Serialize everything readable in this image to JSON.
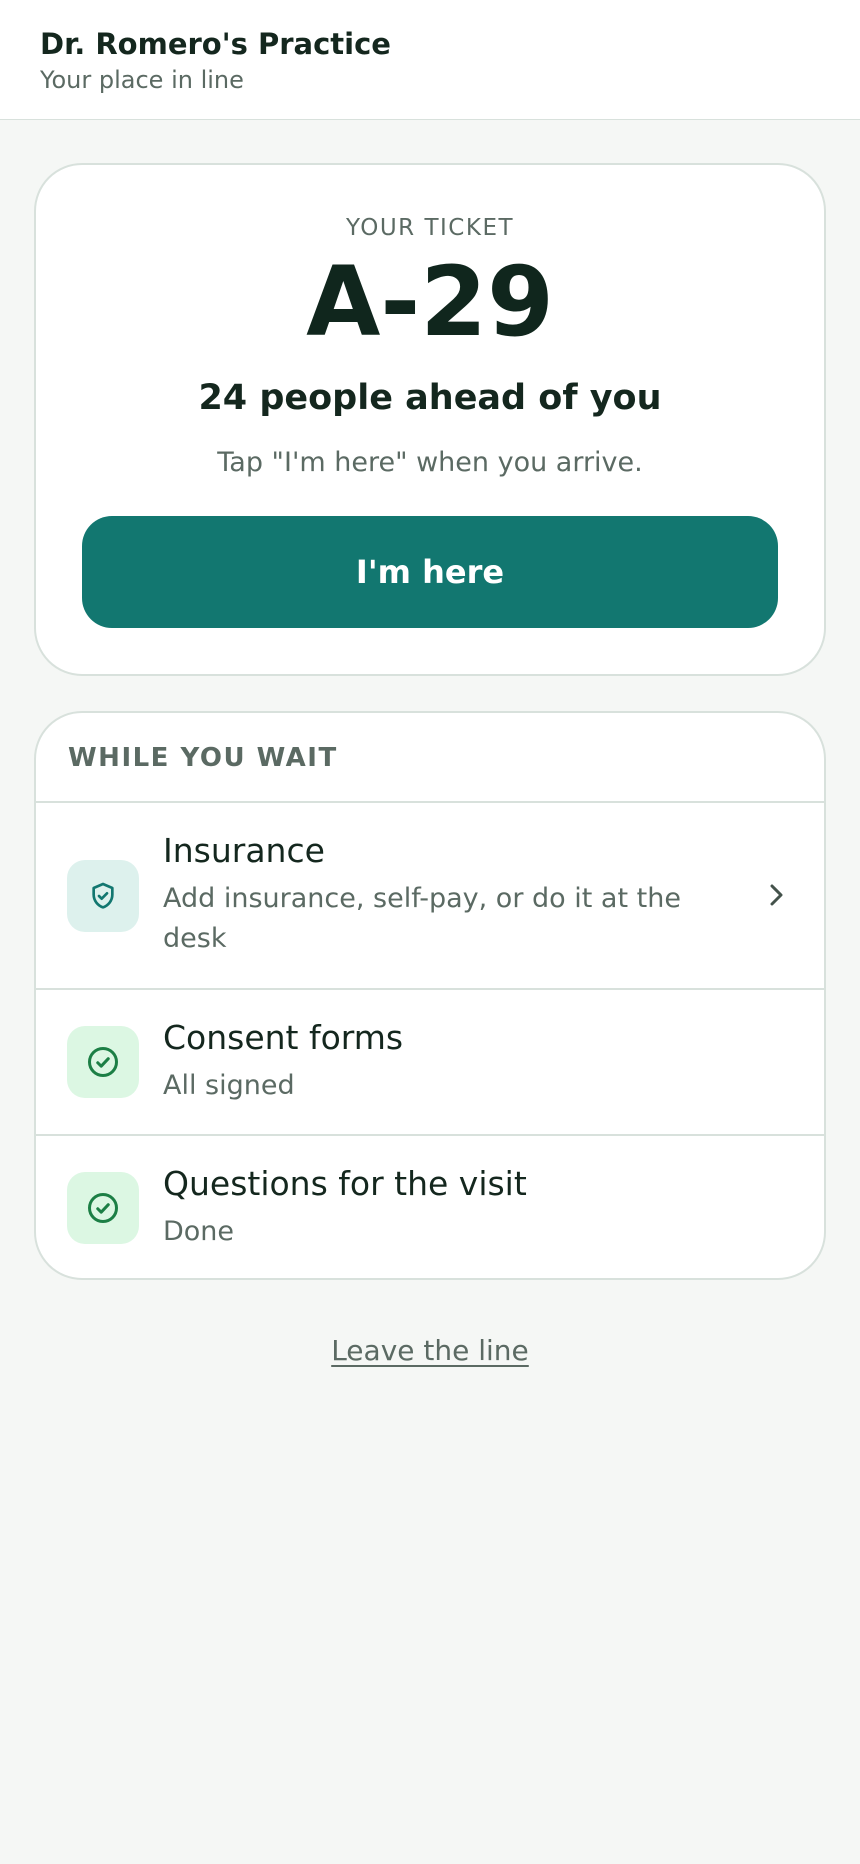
{
  "header": {
    "title": "Dr. Romero's Practice",
    "subtitle": "Your place in line"
  },
  "ticket": {
    "label": "YOUR TICKET",
    "number": "A-29",
    "people_ahead": "24 people ahead of you",
    "hint": "Tap \"I'm here\" when you arrive.",
    "button_label": "I'm here"
  },
  "wait": {
    "heading": "WHILE YOU WAIT",
    "items": [
      {
        "title": "Insurance",
        "subtitle": "Add insurance, self-pay, or do it at the desk",
        "icon": "shield-check-icon",
        "has_chevron": true
      },
      {
        "title": "Consent forms",
        "subtitle": "All signed",
        "icon": "check-circle-icon",
        "has_chevron": false
      },
      {
        "title": "Questions for the visit",
        "subtitle": "Done",
        "icon": "check-circle-icon",
        "has_chevron": false
      }
    ]
  },
  "leave_label": "Leave the line",
  "colors": {
    "accent": "#127770",
    "success": "#1c7f45",
    "background": "#f5f7f5",
    "text_primary": "#14271e",
    "text_secondary": "#5b6a63"
  }
}
